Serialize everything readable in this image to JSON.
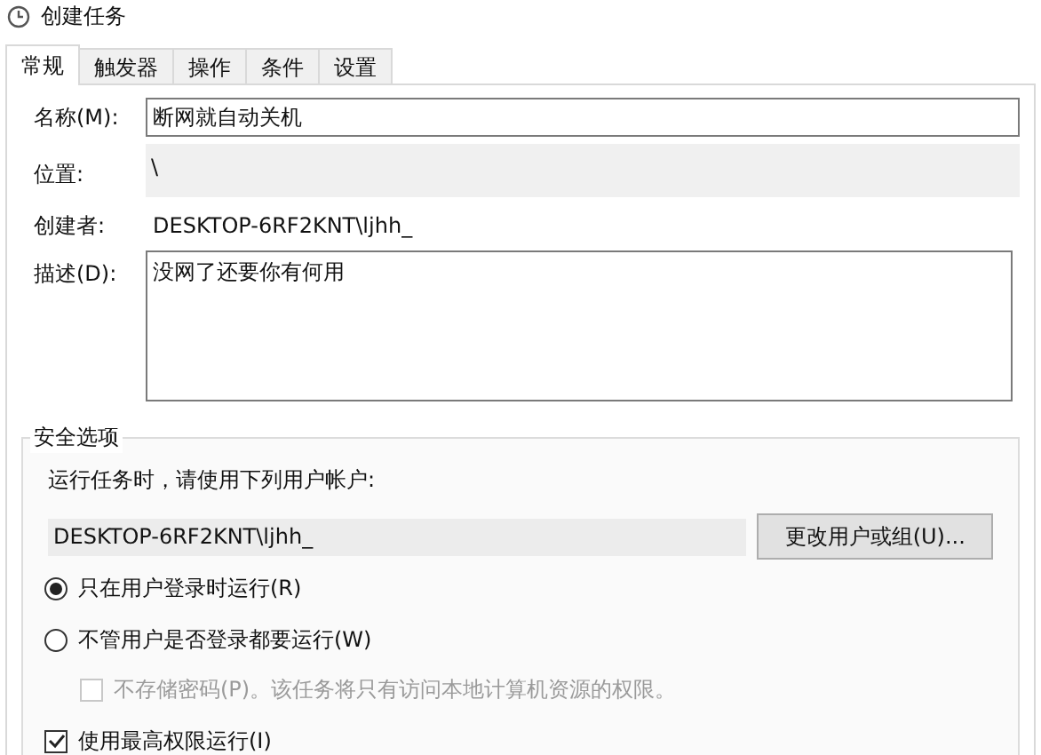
{
  "window": {
    "title": "创建任务"
  },
  "tabs": [
    {
      "label": "常规",
      "selected": true
    },
    {
      "label": "触发器",
      "selected": false
    },
    {
      "label": "操作",
      "selected": false
    },
    {
      "label": "条件",
      "selected": false
    },
    {
      "label": "设置",
      "selected": false
    }
  ],
  "general": {
    "name": {
      "label": "名称(M):",
      "value": "断网就自动关机"
    },
    "location": {
      "label": "位置:",
      "value": "\\"
    },
    "author": {
      "label": "创建者:",
      "value": "DESKTOP-6RF2KNT\\ljhh_"
    },
    "description": {
      "label": "描述(D):",
      "value": "没网了还要你有何用"
    }
  },
  "security": {
    "title": "安全选项",
    "prompt": "运行任务时，请使用下列用户帐户:",
    "user_account": "DESKTOP-6RF2KNT\\ljhh_",
    "change_button": "更改用户或组(U)...",
    "run_options": [
      {
        "label": "只在用户登录时运行(R)",
        "selected": true
      },
      {
        "label": "不管用户是否登录都要运行(W)",
        "selected": false
      }
    ],
    "do_not_store_password": {
      "label": "不存储密码(P)。该任务将只有访问本地计算机资源的权限。",
      "checked": false,
      "disabled": true
    },
    "run_highest": {
      "label": "使用最高权限运行(I)",
      "checked": true,
      "disabled": false
    }
  }
}
